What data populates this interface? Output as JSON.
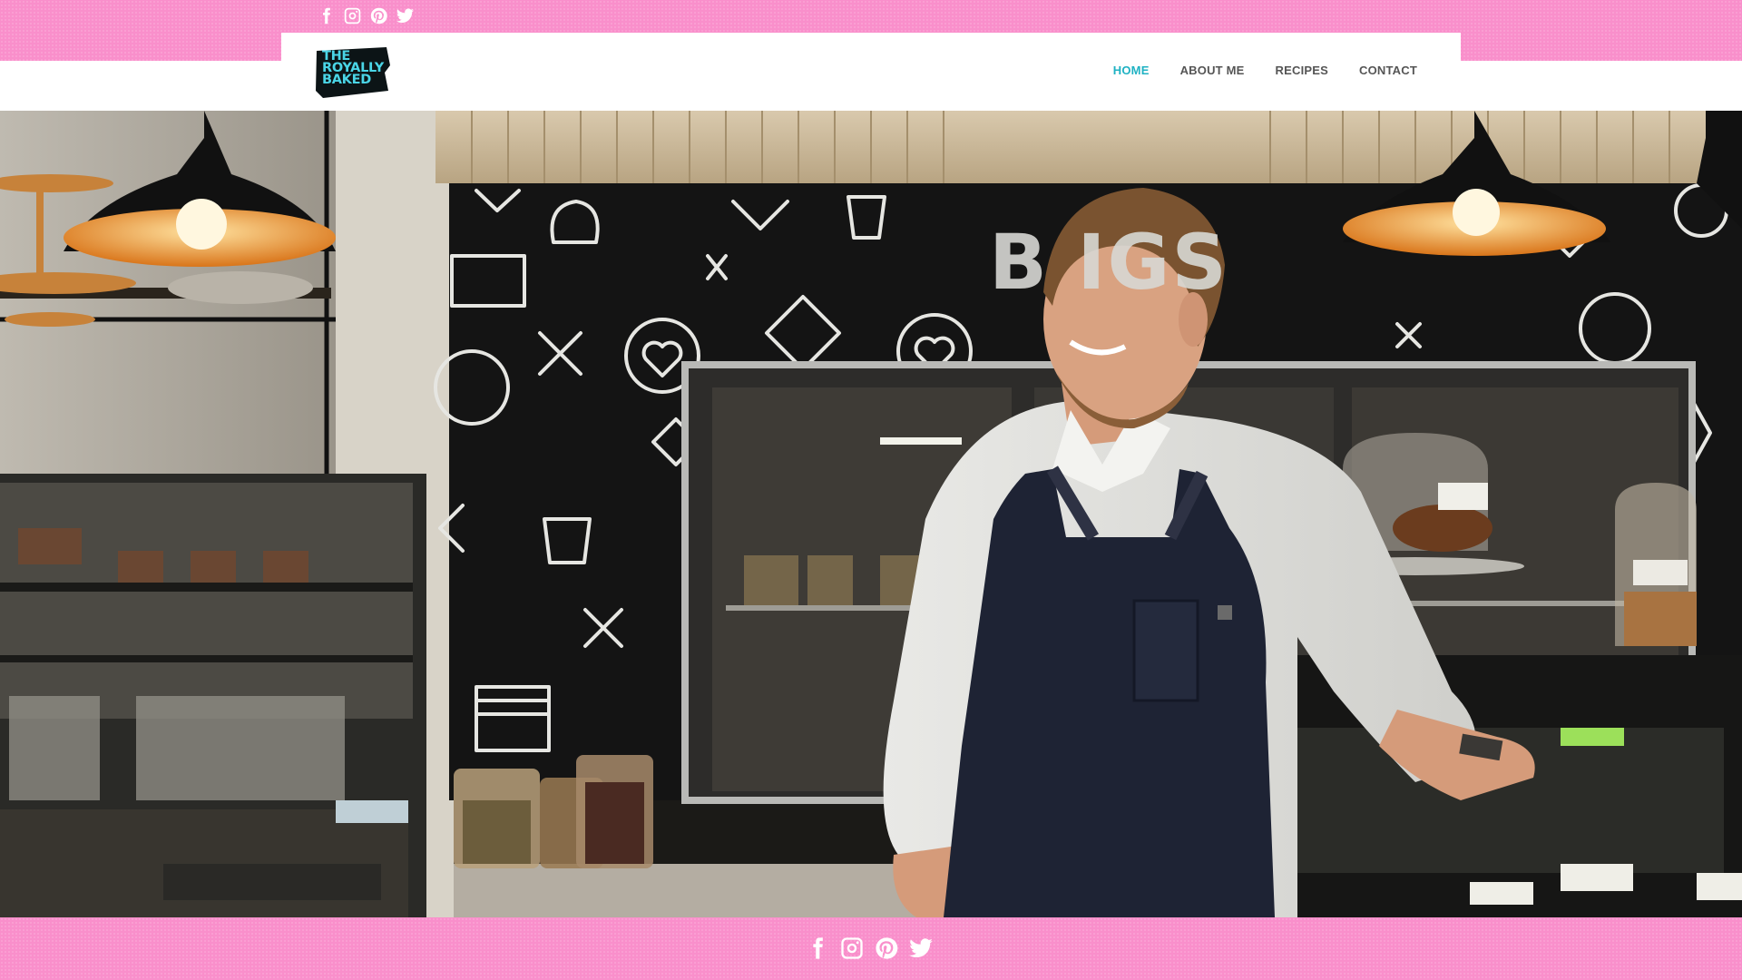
{
  "brand": {
    "logo_lines": [
      "THE",
      "ROYALLY",
      "BAKED"
    ],
    "accent_color": "#4ad5e6",
    "band_color": "#f98fcb"
  },
  "social": {
    "icons": [
      "facebook-icon",
      "instagram-icon",
      "pinterest-icon",
      "twitter-icon"
    ]
  },
  "nav": {
    "items": [
      {
        "label": "HOME",
        "active": true
      },
      {
        "label": "ABOUT ME",
        "active": false
      },
      {
        "label": "RECIPES",
        "active": false
      },
      {
        "label": "CONTACT",
        "active": false
      }
    ],
    "active_color": "#1fb2c3"
  },
  "hero": {
    "description": "Baker in white shirt and navy apron smiling in a bakery",
    "chalkboard_text": "B    IGS"
  }
}
